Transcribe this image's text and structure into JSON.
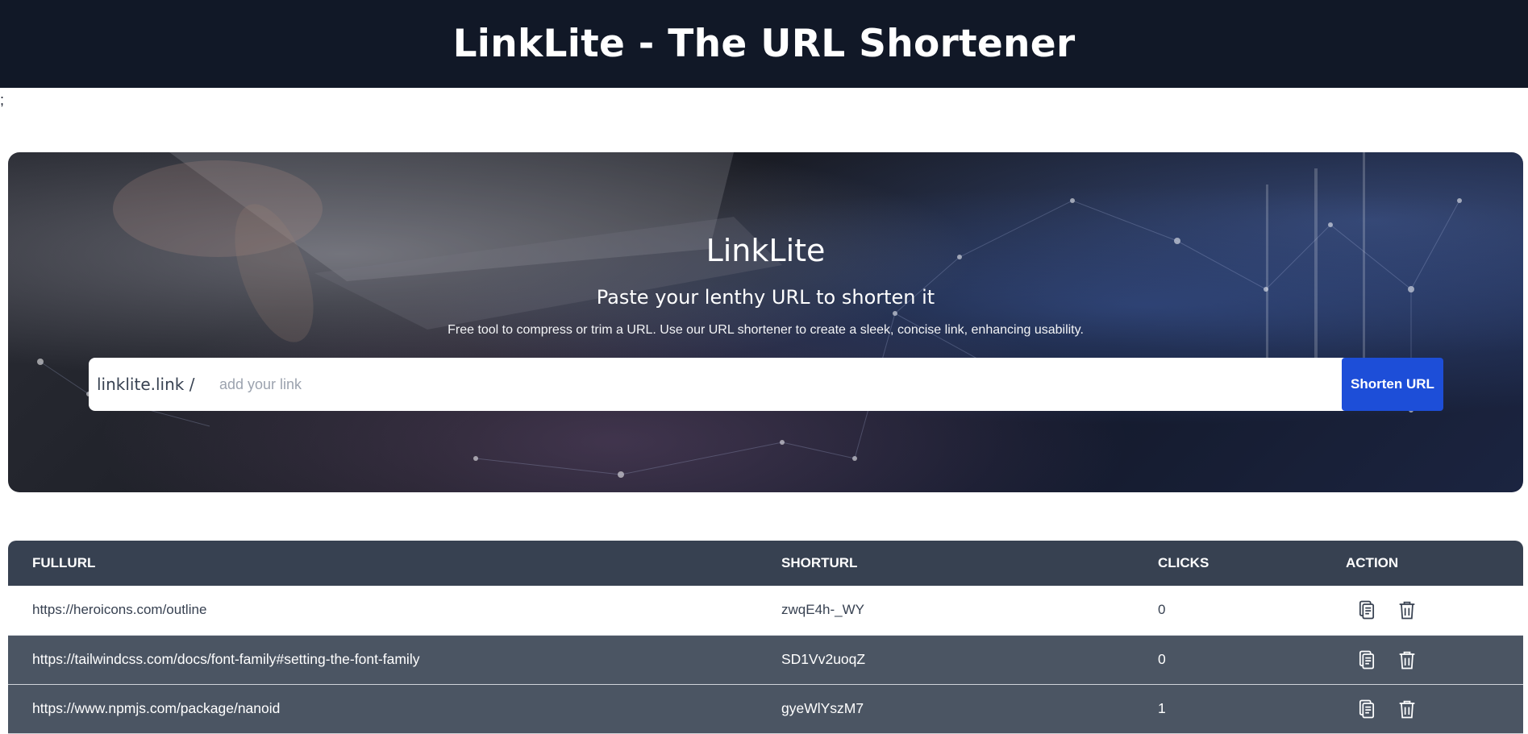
{
  "header": {
    "title": "LinkLite - The URL Shortener"
  },
  "stray_text": ";",
  "hero": {
    "title": "LinkLite",
    "subtitle": "Paste your lenthy URL to shorten it",
    "description": "Free tool to compress or trim a URL. Use our URL shortener to create a sleek, concise link, enhancing usability."
  },
  "form": {
    "prefix": "linklite.link /",
    "placeholder": "add your link",
    "value": "",
    "button_label": "Shorten URL"
  },
  "table": {
    "headers": [
      "FullUrl",
      "ShortUrl",
      "Clicks",
      "Action"
    ],
    "rows": [
      {
        "full_url": "https://heroicons.com/outline",
        "short_url": "zwqE4h-_WY",
        "clicks": "0"
      },
      {
        "full_url": "https://tailwindcss.com/docs/font-family#setting-the-font-family",
        "short_url": "SD1Vv2uoqZ",
        "clicks": "0"
      },
      {
        "full_url": "https://www.npmjs.com/package/nanoid",
        "short_url": "gyeWlYszM7",
        "clicks": "1"
      }
    ]
  },
  "icons": {
    "copy": "clipboard-copy-icon",
    "delete": "trash-icon"
  },
  "colors": {
    "header_bg": "#111827",
    "table_header_bg": "#374151",
    "row_dark_bg": "#4b5563",
    "button_bg": "#1d4ed8"
  }
}
